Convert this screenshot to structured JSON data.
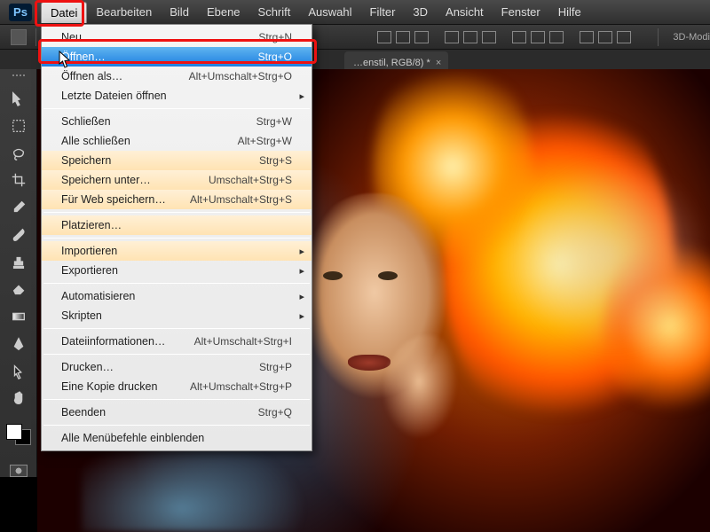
{
  "app": {
    "logo": "Ps"
  },
  "menu": {
    "items": [
      "Datei",
      "Bearbeiten",
      "Bild",
      "Ebene",
      "Schrift",
      "Auswahl",
      "Filter",
      "3D",
      "Ansicht",
      "Fenster",
      "Hilfe"
    ],
    "active_index": 0
  },
  "options_bar": {
    "mode3d_label": "3D-Modi"
  },
  "tabs": [
    {
      "title": "…enstil, RGB/8) *"
    }
  ],
  "dropdown": {
    "groups": [
      [
        {
          "label": "Neu…",
          "shortcut": "Strg+N"
        },
        {
          "label": "Öffnen…",
          "shortcut": "Strg+O",
          "highlight": true
        },
        {
          "label": "Öffnen als…",
          "shortcut": "Alt+Umschalt+Strg+O"
        },
        {
          "label": "Letzte Dateien öffnen",
          "submenu": true
        }
      ],
      [
        {
          "label": "Schließen",
          "shortcut": "Strg+W"
        },
        {
          "label": "Alle schließen",
          "shortcut": "Alt+Strg+W"
        },
        {
          "label": "Speichern",
          "shortcut": "Strg+S",
          "warm": true
        },
        {
          "label": "Speichern unter…",
          "shortcut": "Umschalt+Strg+S",
          "warm": true
        },
        {
          "label": "Für Web speichern…",
          "shortcut": "Alt+Umschalt+Strg+S",
          "warm": true
        }
      ],
      [
        {
          "label": "Platzieren…",
          "warm": true
        }
      ],
      [
        {
          "label": "Importieren",
          "submenu": true,
          "warm": true
        },
        {
          "label": "Exportieren",
          "submenu": true
        }
      ],
      [
        {
          "label": "Automatisieren",
          "submenu": true
        },
        {
          "label": "Skripten",
          "submenu": true
        }
      ],
      [
        {
          "label": "Dateiinformationen…",
          "shortcut": "Alt+Umschalt+Strg+I"
        }
      ],
      [
        {
          "label": "Drucken…",
          "shortcut": "Strg+P"
        },
        {
          "label": "Eine Kopie drucken",
          "shortcut": "Alt+Umschalt+Strg+P"
        }
      ],
      [
        {
          "label": "Beenden",
          "shortcut": "Strg+Q"
        }
      ],
      [
        {
          "label": "Alle Menübefehle einblenden"
        }
      ]
    ]
  },
  "tools": [
    "move",
    "marquee",
    "lasso",
    "crop",
    "eyedropper",
    "brush",
    "stamp",
    "eraser",
    "gradient",
    "pen",
    "path-select",
    "hand"
  ]
}
